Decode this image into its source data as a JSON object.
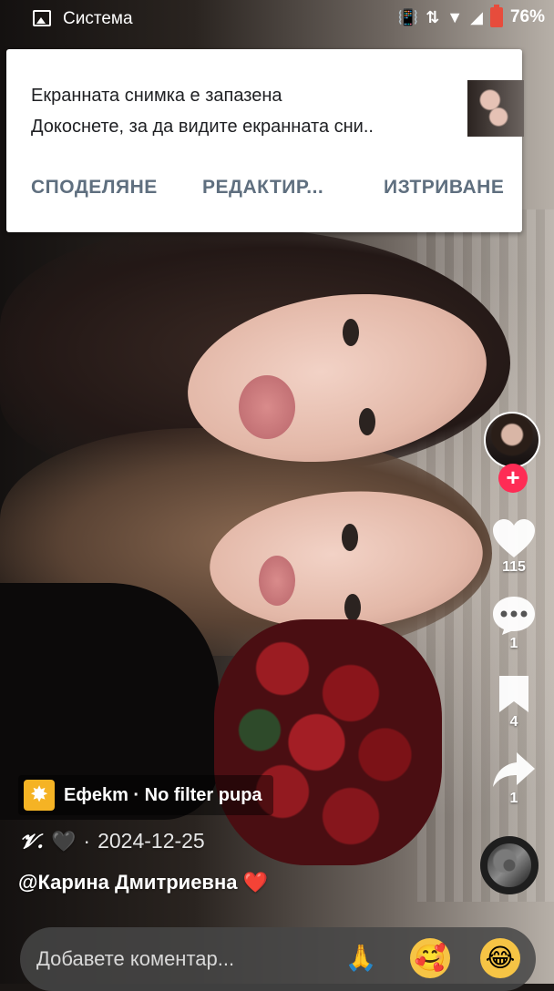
{
  "status_bar": {
    "app_name": "Система",
    "battery_percent": "76%"
  },
  "notification": {
    "title": "Екранната снимка е запазена",
    "body": "Докоснете, за да видите екранната сни..",
    "actions": [
      "СПОДЕЛЯНЕ",
      "РЕДАКТИР...",
      "ИЗТРИВАНЕ"
    ]
  },
  "actions": {
    "likes": "115",
    "comments": "1",
    "saves": "4",
    "shares": "1",
    "follow_symbol": "+"
  },
  "post": {
    "effect_label": "Ефekm · No filter pupa",
    "author": "𝓥.",
    "author_emoji": "🖤",
    "separator": "·",
    "date": "2024-12-25",
    "caption": "@Карина Дмитриевна",
    "caption_emoji": "❤️"
  },
  "comment_bar": {
    "placeholder": "Добавете коментар...",
    "emojis": [
      "🙏",
      "🥰",
      "😂"
    ]
  },
  "colors": {
    "follow_button": "#fe2c55",
    "effect_icon": "#f5b324",
    "notification_action": "#5f6f7f"
  }
}
